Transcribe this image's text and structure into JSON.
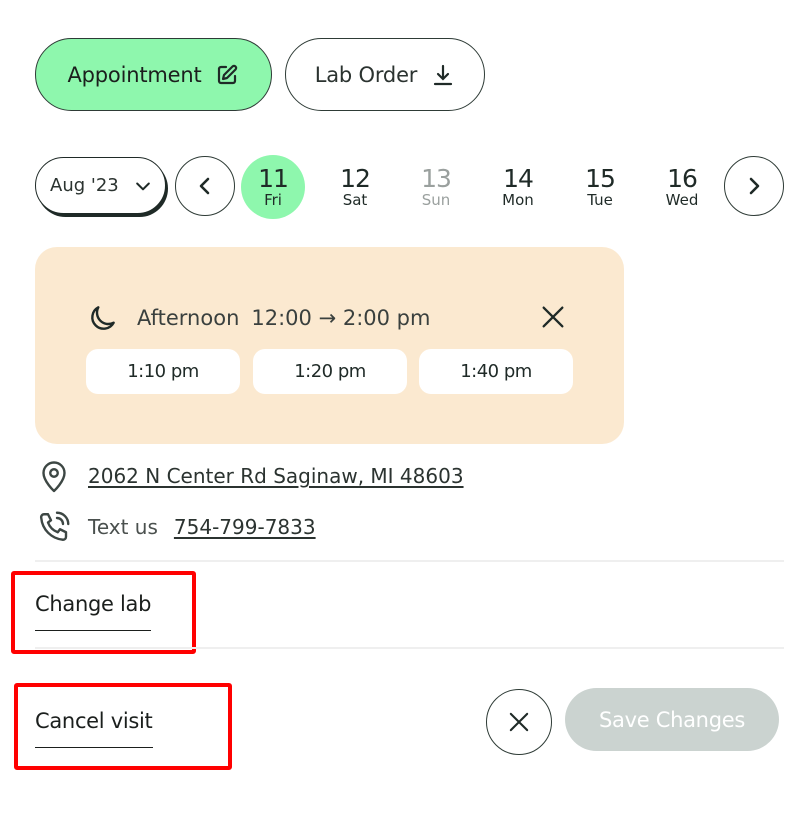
{
  "tabs": {
    "appointment": {
      "label": "Appointment",
      "icon": "edit-icon",
      "active": true
    },
    "lab_order": {
      "label": "Lab Order",
      "icon": "download-icon",
      "active": false
    }
  },
  "calendar": {
    "month_label": "Aug '23",
    "days": [
      {
        "num": "11",
        "dow": "Fri",
        "state": "selected"
      },
      {
        "num": "12",
        "dow": "Sat",
        "state": "normal"
      },
      {
        "num": "13",
        "dow": "Sun",
        "state": "disabled"
      },
      {
        "num": "14",
        "dow": "Mon",
        "state": "normal"
      },
      {
        "num": "15",
        "dow": "Tue",
        "state": "normal"
      },
      {
        "num": "16",
        "dow": "Wed",
        "state": "normal"
      }
    ]
  },
  "time_panel": {
    "period_icon": "moon-icon",
    "period_label": "Afternoon",
    "period_range": "12:00 → 2:00 pm",
    "slots": [
      "1:10 pm",
      "1:20 pm",
      "1:40 pm"
    ]
  },
  "location": {
    "address": "2062 N Center Rd Saginaw, MI 48603",
    "text_label": "Text us",
    "phone": "754-799-7833"
  },
  "actions": {
    "change_lab": "Change lab",
    "cancel_visit": "Cancel visit",
    "save_changes": "Save Changes"
  },
  "colors": {
    "accent_green": "#8ef7ad",
    "panel_bg": "#fbe9d0",
    "disabled_button": "#cbd3d0",
    "highlight_red": "#ff0000"
  }
}
